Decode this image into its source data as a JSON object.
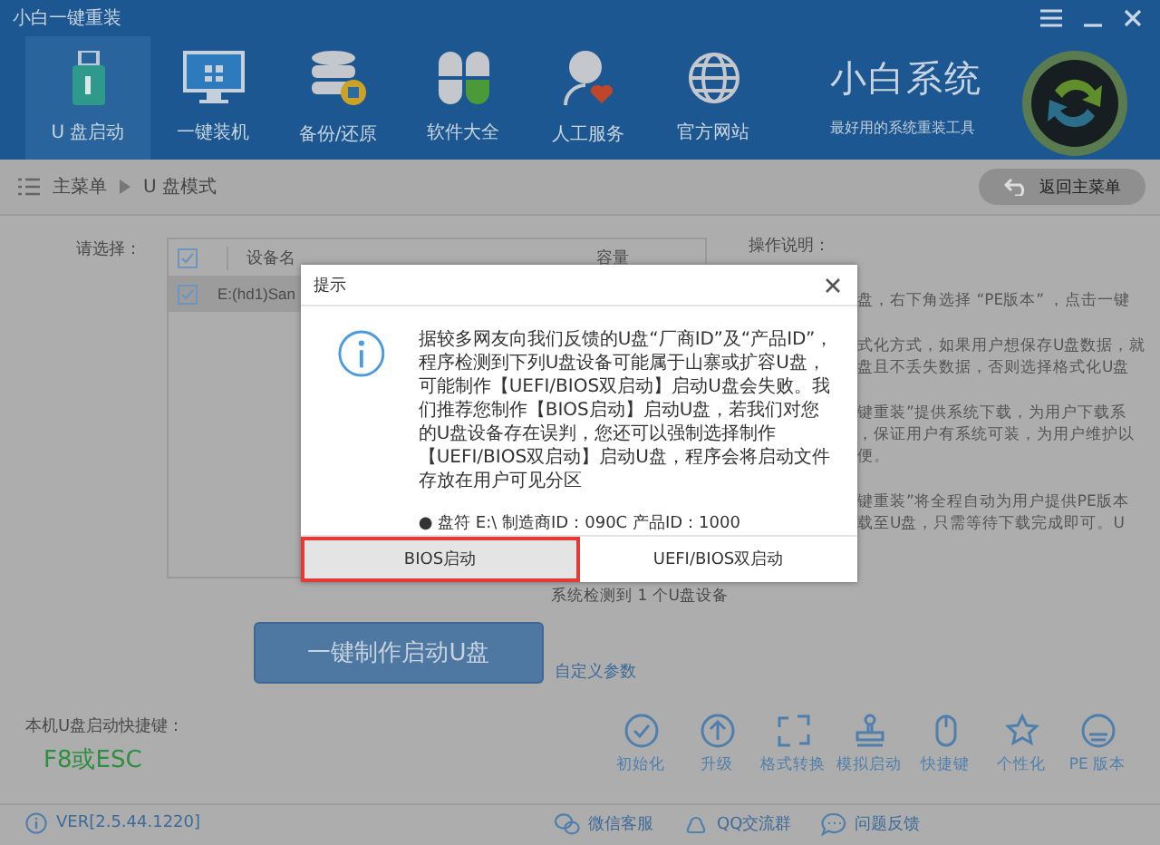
{
  "window": {
    "title": "小白一键重装"
  },
  "nav": {
    "items": [
      {
        "label": "U 盘启动",
        "selected": true
      },
      {
        "label": "一键装机",
        "selected": false
      },
      {
        "label": "备份/还原",
        "selected": false
      },
      {
        "label": "软件大全",
        "selected": false
      },
      {
        "label": "人工服务",
        "selected": false
      },
      {
        "label": "官方网站",
        "selected": false
      }
    ]
  },
  "brand": {
    "name": "小白系统",
    "slogan": "最好用的系统重装工具"
  },
  "breadcrumb": {
    "items": [
      "主菜单",
      "U 盘模式"
    ],
    "back_button": "返回主菜单"
  },
  "device_panel": {
    "label": "请选择：",
    "header_checked": true,
    "columns": [
      "设备名",
      "容量"
    ],
    "rows": [
      {
        "name": "E:(hd1)San",
        "checked": true,
        "selected": true
      }
    ]
  },
  "status": "系统检测到 1 个U盘设备",
  "make_button": "一键制作启动U盘",
  "custom_link": "自定义参数",
  "instructions": {
    "title": "操作说明：",
    "paragraphs": [
      [
        "盘，右下角选择 “PE版本” ，点击一键"
      ],
      [
        "式化方式，如果用户想保存U盘数据，就",
        "盘且不丢失数据，否则选择格式化U盘"
      ],
      [
        "键重装”提供系统下载，为用户下载系",
        "，保证用户有系统可装，为用户维护以",
        "便。"
      ],
      [
        "键重装”将全程自动为用户提供PE版本",
        "载至U盘，只需等待下载完成即可。U"
      ]
    ]
  },
  "shortcut": {
    "label": "本机U盘启动快捷键：",
    "keys": "F8或ESC"
  },
  "tools": [
    {
      "label": "初始化"
    },
    {
      "label": "升级"
    },
    {
      "label": "格式转换"
    },
    {
      "label": "模拟启动"
    },
    {
      "label": "快捷键"
    },
    {
      "label": "个性化"
    },
    {
      "label": "PE 版本"
    }
  ],
  "footer": {
    "version": "VER[2.5.44.1220]",
    "links": [
      "微信客服",
      "QQ交流群",
      "问题反馈"
    ]
  },
  "dialog": {
    "title": "提示",
    "message": "据较多网友向我们反馈的U盘“厂商ID”及“产品ID”，程序检测到下列U盘设备可能属于山寨或扩容U盘，可能制作【UEFI/BIOS双启动】启动U盘会失败。我们推荐您制作【BIOS启动】启动U盘，若我们对您的U盘设备存在误判，您还可以强制选择制作【UEFI/BIOS双启动】启动U盘，程序会将启动文件存放在用户可见分区",
    "detail": "● 盘符 E:\\ 制造商ID：090C 产品ID：1000",
    "buttons": [
      {
        "label": "BIOS启动",
        "selected": true
      },
      {
        "label": "UEFI/BIOS双启动",
        "selected": false
      }
    ]
  }
}
